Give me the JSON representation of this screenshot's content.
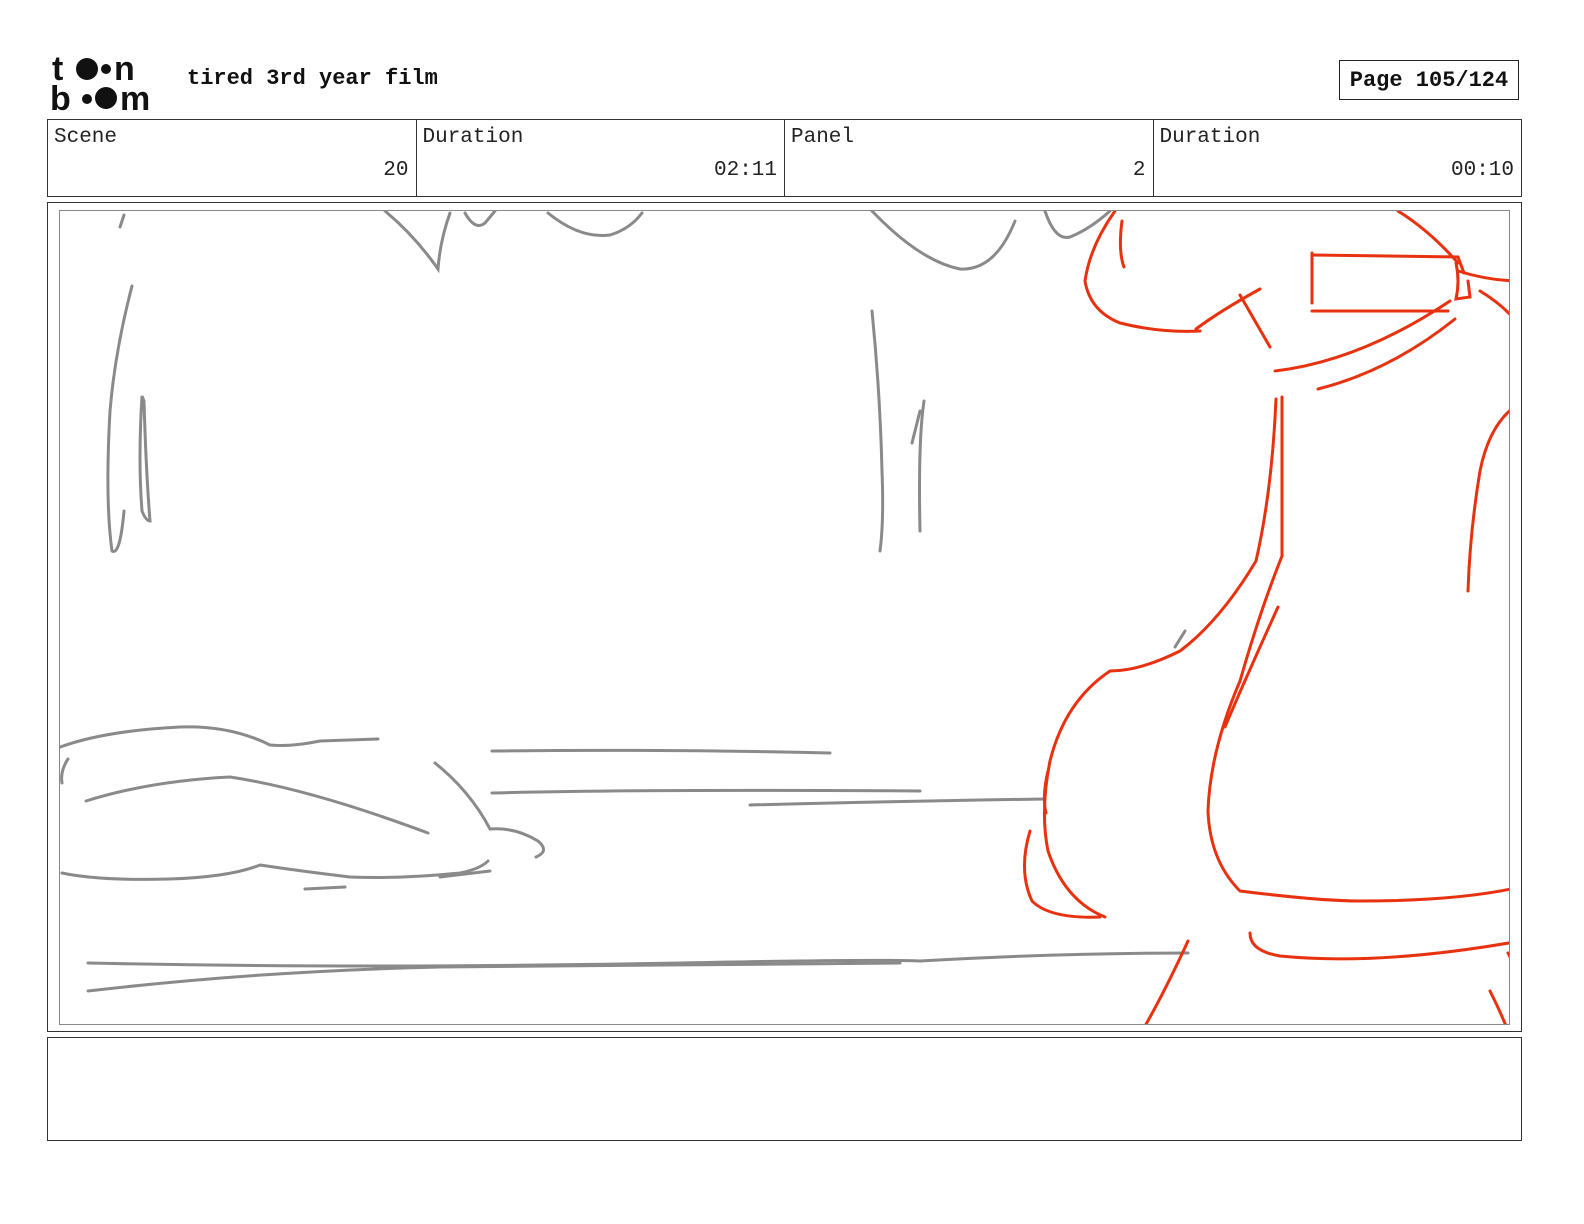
{
  "header": {
    "logo_text": "toon boom",
    "project_title": "tired 3rd year film",
    "page_label": "Page 105/124"
  },
  "info": [
    {
      "label": "Scene",
      "value": "20"
    },
    {
      "label": "Duration",
      "value": "02:11"
    },
    {
      "label": "Panel",
      "value": "2"
    },
    {
      "label": "Duration",
      "value": "00:10"
    }
  ],
  "panel": {
    "background_sketch_color": "#8a8a8a",
    "character_sketch_color": "#e8320f"
  },
  "notes": {
    "text": ""
  }
}
